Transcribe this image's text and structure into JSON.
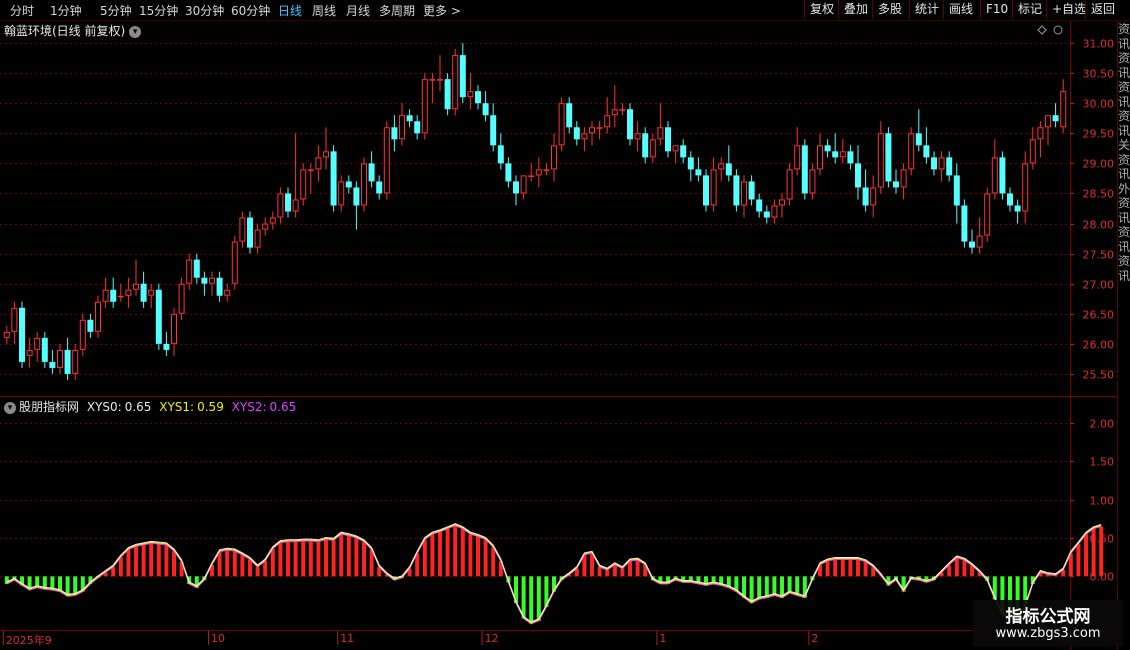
{
  "toolbar": {
    "timeframes": [
      "分时",
      "1分钟",
      "5分钟",
      "15分钟",
      "30分钟",
      "60分钟",
      "日线",
      "周线",
      "月线",
      "多周期",
      "更多"
    ],
    "active_timeframe": "日线",
    "right_buttons": [
      "复权",
      "叠加",
      "多股",
      "统计",
      "画线",
      "F10",
      "标记",
      "+自选",
      "返回"
    ]
  },
  "main_chart": {
    "title": "翰蓝环境(日线 前复权)"
  },
  "indicator": {
    "name": "股朋指标网",
    "values": [
      {
        "label": "XYS0:",
        "value": "0.65",
        "color": "#e6e6e6"
      },
      {
        "label": "XYS1:",
        "value": "0.59",
        "color": "#f0f000"
      },
      {
        "label": "XYS2:",
        "value": "0.65",
        "color": "#e040ff"
      }
    ]
  },
  "right_strip_text": "资讯资讯资讯资讯关资讯外资讯资讯资讯",
  "watermark": {
    "line1": "指标公式网",
    "line2": "www.zbgs3.com"
  },
  "time_axis": [
    {
      "label": "2025年9",
      "idx": 0
    },
    {
      "label": "10",
      "idx": 27
    },
    {
      "label": "11",
      "idx": 44
    },
    {
      "label": "12",
      "idx": 63
    },
    {
      "label": "1",
      "idx": 86
    },
    {
      "label": "2",
      "idx": 106
    }
  ],
  "chart_data": [
    {
      "type": "candlestick",
      "title": "翰蓝环境(日线 前复权)",
      "ylim": [
        25.2,
        31.3
      ],
      "yticks": [
        25.5,
        26.0,
        26.5,
        27.0,
        27.5,
        28.0,
        28.5,
        29.0,
        29.5,
        30.0,
        30.5,
        31.0
      ],
      "up_color": "#ff3232",
      "down_color": "#54ffff",
      "ohlc": [
        [
          26.1,
          26.3,
          26.0,
          26.2
        ],
        [
          26.2,
          26.7,
          26.0,
          26.6
        ],
        [
          26.6,
          26.7,
          25.6,
          25.7
        ],
        [
          25.8,
          26.1,
          25.6,
          25.9
        ],
        [
          25.9,
          26.2,
          25.7,
          26.1
        ],
        [
          26.1,
          26.2,
          25.6,
          25.7
        ],
        [
          25.7,
          25.9,
          25.5,
          25.6
        ],
        [
          25.6,
          26.0,
          25.5,
          25.9
        ],
        [
          25.9,
          26.1,
          25.4,
          25.5
        ],
        [
          25.5,
          26.0,
          25.4,
          25.9
        ],
        [
          25.9,
          26.5,
          25.8,
          26.4
        ],
        [
          26.4,
          26.5,
          26.1,
          26.2
        ],
        [
          26.2,
          26.8,
          26.1,
          26.7
        ],
        [
          26.7,
          27.1,
          26.6,
          26.9
        ],
        [
          26.9,
          27.1,
          26.6,
          26.7
        ],
        [
          26.8,
          27.0,
          26.7,
          26.8
        ],
        [
          26.8,
          27.1,
          26.6,
          26.9
        ],
        [
          26.9,
          27.4,
          26.8,
          27.0
        ],
        [
          27.0,
          27.2,
          26.6,
          26.7
        ],
        [
          26.8,
          27.0,
          26.6,
          26.9
        ],
        [
          26.9,
          27.0,
          25.9,
          26.0
        ],
        [
          26.0,
          26.2,
          25.8,
          25.9
        ],
        [
          26.0,
          26.6,
          25.8,
          26.5
        ],
        [
          26.5,
          27.1,
          26.4,
          27.0
        ],
        [
          27.0,
          27.5,
          26.9,
          27.4
        ],
        [
          27.4,
          27.5,
          27.0,
          27.1
        ],
        [
          27.1,
          27.2,
          26.8,
          27.0
        ],
        [
          27.0,
          27.2,
          26.8,
          27.1
        ],
        [
          27.1,
          27.2,
          26.7,
          26.8
        ],
        [
          26.8,
          27.0,
          26.7,
          26.9
        ],
        [
          27.0,
          27.8,
          26.9,
          27.7
        ],
        [
          27.7,
          28.2,
          27.6,
          28.1
        ],
        [
          28.1,
          28.2,
          27.5,
          27.6
        ],
        [
          27.6,
          28.0,
          27.5,
          27.9
        ],
        [
          27.9,
          28.1,
          27.8,
          28.0
        ],
        [
          28.0,
          28.2,
          27.9,
          28.1
        ],
        [
          28.1,
          28.6,
          28.0,
          28.5
        ],
        [
          28.5,
          28.6,
          28.1,
          28.2
        ],
        [
          28.2,
          29.5,
          28.1,
          28.4
        ],
        [
          28.4,
          29.0,
          28.3,
          28.9
        ],
        [
          28.9,
          29.0,
          28.5,
          28.9
        ],
        [
          28.9,
          29.3,
          28.7,
          29.1
        ],
        [
          29.1,
          29.6,
          28.9,
          29.2
        ],
        [
          29.2,
          29.3,
          28.2,
          28.3
        ],
        [
          28.3,
          28.8,
          28.2,
          28.7
        ],
        [
          28.7,
          28.8,
          28.5,
          28.6
        ],
        [
          28.6,
          28.7,
          27.9,
          28.3
        ],
        [
          28.3,
          29.1,
          28.2,
          29.0
        ],
        [
          29.0,
          29.2,
          28.6,
          28.7
        ],
        [
          28.7,
          28.8,
          28.4,
          28.5
        ],
        [
          28.5,
          29.7,
          28.4,
          29.6
        ],
        [
          29.6,
          29.8,
          29.2,
          29.4
        ],
        [
          29.4,
          30.0,
          29.3,
          29.8
        ],
        [
          29.8,
          29.9,
          29.6,
          29.7
        ],
        [
          29.7,
          29.8,
          29.4,
          29.5
        ],
        [
          29.5,
          30.5,
          29.4,
          30.4
        ],
        [
          30.4,
          30.5,
          30.0,
          30.4
        ],
        [
          30.4,
          30.8,
          30.2,
          30.4
        ],
        [
          30.4,
          30.5,
          29.8,
          29.9
        ],
        [
          29.9,
          30.9,
          29.8,
          30.8
        ],
        [
          30.8,
          31.0,
          30.0,
          30.1
        ],
        [
          30.1,
          30.5,
          29.9,
          30.2
        ],
        [
          30.2,
          30.3,
          29.9,
          30.0
        ],
        [
          30.0,
          30.2,
          29.7,
          29.8
        ],
        [
          29.8,
          30.0,
          29.2,
          29.3
        ],
        [
          29.3,
          29.5,
          28.9,
          29.0
        ],
        [
          29.0,
          29.1,
          28.6,
          28.7
        ],
        [
          28.7,
          28.8,
          28.3,
          28.5
        ],
        [
          28.5,
          28.8,
          28.4,
          28.8
        ],
        [
          28.8,
          29.0,
          28.7,
          28.8
        ],
        [
          28.8,
          29.1,
          28.6,
          28.9
        ],
        [
          28.9,
          29.0,
          28.8,
          28.9
        ],
        [
          28.9,
          29.5,
          28.7,
          29.3
        ],
        [
          29.3,
          30.1,
          29.2,
          30.0
        ],
        [
          30.0,
          30.1,
          29.5,
          29.6
        ],
        [
          29.6,
          29.7,
          29.3,
          29.4
        ],
        [
          29.4,
          29.6,
          29.2,
          29.5
        ],
        [
          29.5,
          29.7,
          29.3,
          29.6
        ],
        [
          29.6,
          29.7,
          29.4,
          29.6
        ],
        [
          29.6,
          30.1,
          29.5,
          29.8
        ],
        [
          29.8,
          30.3,
          29.6,
          29.9
        ],
        [
          29.9,
          30.0,
          29.8,
          29.9
        ],
        [
          29.9,
          30.0,
          29.3,
          29.4
        ],
        [
          29.4,
          29.7,
          29.2,
          29.5
        ],
        [
          29.5,
          29.6,
          29.0,
          29.1
        ],
        [
          29.1,
          29.5,
          29.0,
          29.4
        ],
        [
          29.4,
          30.0,
          29.3,
          29.6
        ],
        [
          29.6,
          29.7,
          29.1,
          29.2
        ],
        [
          29.2,
          29.3,
          29.0,
          29.3
        ],
        [
          29.3,
          29.4,
          29.0,
          29.1
        ],
        [
          29.1,
          29.2,
          28.7,
          28.9
        ],
        [
          28.9,
          29.1,
          28.7,
          28.8
        ],
        [
          28.8,
          28.9,
          28.2,
          28.3
        ],
        [
          28.3,
          29.1,
          28.2,
          28.9
        ],
        [
          28.9,
          29.1,
          28.7,
          29.0
        ],
        [
          29.0,
          29.3,
          28.7,
          28.8
        ],
        [
          28.8,
          28.9,
          28.2,
          28.3
        ],
        [
          28.3,
          28.8,
          28.1,
          28.7
        ],
        [
          28.7,
          28.8,
          28.3,
          28.4
        ],
        [
          28.4,
          28.5,
          28.1,
          28.2
        ],
        [
          28.2,
          28.3,
          28.0,
          28.1
        ],
        [
          28.1,
          28.4,
          28.0,
          28.3
        ],
        [
          28.3,
          28.5,
          28.1,
          28.4
        ],
        [
          28.4,
          29.0,
          28.3,
          28.9
        ],
        [
          28.9,
          29.6,
          28.8,
          29.3
        ],
        [
          29.3,
          29.4,
          28.4,
          28.5
        ],
        [
          28.5,
          29.0,
          28.4,
          28.9
        ],
        [
          28.9,
          29.5,
          28.8,
          29.3
        ],
        [
          29.3,
          29.4,
          29.1,
          29.2
        ],
        [
          29.2,
          29.5,
          29.0,
          29.1
        ],
        [
          29.1,
          29.4,
          29.0,
          29.2
        ],
        [
          29.2,
          29.3,
          28.9,
          29.0
        ],
        [
          29.0,
          29.3,
          28.4,
          28.6
        ],
        [
          28.6,
          28.9,
          28.2,
          28.3
        ],
        [
          28.3,
          28.8,
          28.1,
          28.6
        ],
        [
          28.6,
          29.7,
          28.5,
          29.5
        ],
        [
          29.5,
          29.6,
          28.6,
          28.7
        ],
        [
          28.7,
          28.9,
          28.5,
          28.6
        ],
        [
          28.6,
          29.0,
          28.4,
          28.9
        ],
        [
          28.9,
          29.6,
          28.8,
          29.5
        ],
        [
          29.5,
          29.9,
          29.2,
          29.3
        ],
        [
          29.3,
          29.6,
          29.0,
          29.1
        ],
        [
          29.1,
          29.2,
          28.8,
          28.9
        ],
        [
          28.9,
          29.2,
          28.7,
          29.1
        ],
        [
          29.1,
          29.2,
          28.7,
          28.8
        ],
        [
          28.8,
          29.0,
          28.0,
          28.3
        ],
        [
          28.3,
          28.4,
          27.6,
          27.7
        ],
        [
          27.7,
          27.9,
          27.5,
          27.6
        ],
        [
          27.6,
          28.1,
          27.5,
          27.8
        ],
        [
          27.8,
          28.6,
          27.7,
          28.5
        ],
        [
          28.5,
          29.4,
          28.4,
          29.1
        ],
        [
          29.1,
          29.2,
          28.4,
          28.5
        ],
        [
          28.5,
          28.6,
          28.2,
          28.3
        ],
        [
          28.3,
          28.4,
          28.0,
          28.2
        ],
        [
          28.2,
          29.2,
          28.0,
          29.0
        ],
        [
          29.0,
          29.6,
          28.9,
          29.4
        ],
        [
          29.4,
          29.7,
          29.1,
          29.6
        ],
        [
          29.6,
          29.8,
          29.3,
          29.8
        ],
        [
          29.8,
          30.0,
          29.6,
          29.7
        ],
        [
          29.6,
          30.4,
          29.5,
          30.2
        ]
      ]
    },
    {
      "type": "bar",
      "title": "股朋指标网",
      "ylim": [
        -0.7,
        2.3
      ],
      "yticks": [
        0.0,
        0.5,
        1.0,
        1.5,
        2.0
      ],
      "pos_color": "#ff2222",
      "neg_color": "#33ff22",
      "values": [
        -0.1,
        -0.05,
        -0.12,
        -0.18,
        -0.15,
        -0.17,
        -0.18,
        -0.2,
        -0.26,
        -0.25,
        -0.2,
        -0.1,
        -0.02,
        0.05,
        0.12,
        0.25,
        0.35,
        0.39,
        0.41,
        0.43,
        0.42,
        0.41,
        0.33,
        0.19,
        -0.1,
        -0.15,
        -0.05,
        0.15,
        0.32,
        0.34,
        0.33,
        0.28,
        0.22,
        0.12,
        0.2,
        0.36,
        0.44,
        0.45,
        0.45,
        0.46,
        0.46,
        0.45,
        0.48,
        0.47,
        0.55,
        0.53,
        0.5,
        0.45,
        0.35,
        0.12,
        0.02,
        -0.05,
        -0.02,
        0.1,
        0.3,
        0.48,
        0.55,
        0.58,
        0.62,
        0.66,
        0.62,
        0.55,
        0.52,
        0.48,
        0.38,
        0.2,
        -0.08,
        -0.35,
        -0.55,
        -0.62,
        -0.58,
        -0.4,
        -0.2,
        -0.05,
        0.02,
        0.1,
        0.28,
        0.3,
        0.12,
        0.08,
        0.15,
        0.1,
        0.2,
        0.21,
        0.15,
        -0.05,
        -0.1,
        -0.1,
        -0.05,
        -0.08,
        -0.08,
        -0.1,
        -0.12,
        -0.1,
        -0.12,
        -0.15,
        -0.2,
        -0.28,
        -0.35,
        -0.3,
        -0.28,
        -0.25,
        -0.28,
        -0.22,
        -0.25,
        -0.28,
        -0.05,
        0.15,
        0.2,
        0.22,
        0.22,
        0.22,
        0.22,
        0.19,
        0.12,
        0.01,
        -0.12,
        -0.05,
        -0.2,
        -0.04,
        -0.05,
        -0.08,
        -0.05,
        0.05,
        0.15,
        0.24,
        0.21,
        0.14,
        0.05,
        -0.06,
        -0.3,
        -0.5,
        -0.55,
        -0.58,
        -0.4,
        -0.1,
        0.05,
        0.02,
        0.01,
        0.08,
        0.3,
        0.42,
        0.55,
        0.62,
        0.65
      ]
    }
  ]
}
